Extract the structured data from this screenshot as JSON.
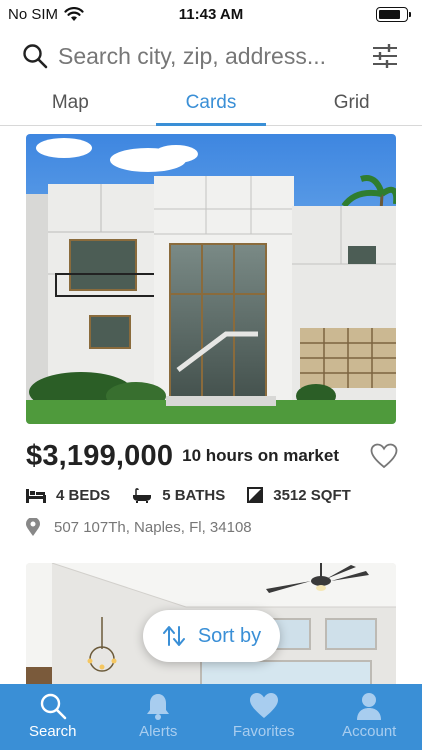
{
  "status_bar": {
    "carrier": "No SIM",
    "time": "11:43 AM",
    "battery_level": 0.8
  },
  "search": {
    "placeholder": "Search city, zip, address..."
  },
  "tabs": [
    {
      "label": "Map",
      "active": false
    },
    {
      "label": "Cards",
      "active": true
    },
    {
      "label": "Grid",
      "active": false
    }
  ],
  "listing": {
    "price": "$3,199,000",
    "market_time": "10 hours on market",
    "beds": "4 BEDS",
    "baths": "5 BATHS",
    "sqft": "3512 SQFT",
    "address": "507 107Th, Naples, Fl, 34108"
  },
  "sort": {
    "label": "Sort by"
  },
  "bottom_nav": [
    {
      "label": "Search",
      "icon": "search-icon",
      "active": true
    },
    {
      "label": "Alerts",
      "icon": "bell-icon",
      "active": false
    },
    {
      "label": "Favorites",
      "icon": "heart-icon",
      "active": false
    },
    {
      "label": "Account",
      "icon": "person-icon",
      "active": false
    }
  ],
  "colors": {
    "accent": "#3a8fd6",
    "nav_inactive": "#a8cdef"
  }
}
